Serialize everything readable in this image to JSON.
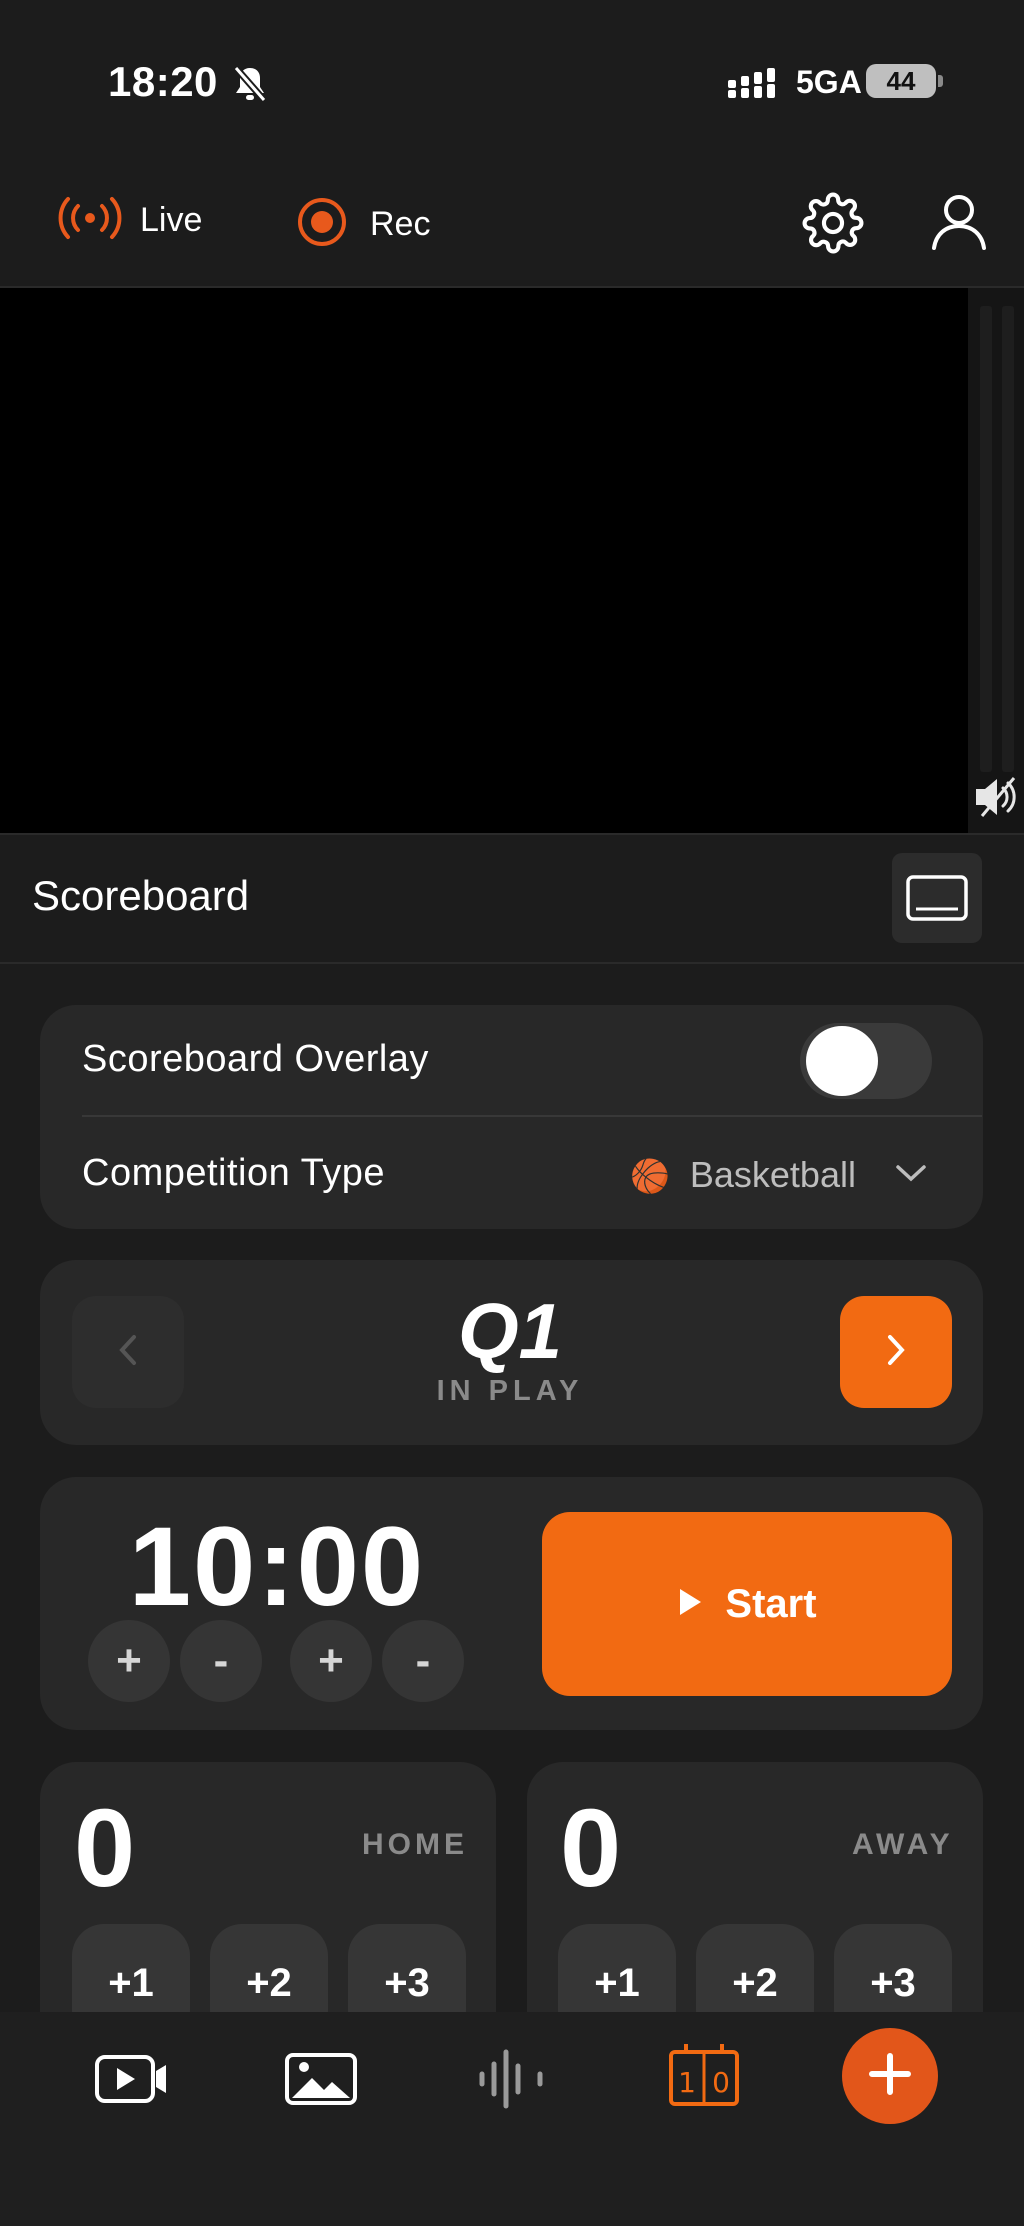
{
  "status_bar": {
    "time": "18:20",
    "network": "5GA",
    "battery": "44"
  },
  "header": {
    "live_label": "Live",
    "rec_label": "Rec"
  },
  "scoreboard": {
    "title": "Scoreboard",
    "overlay_label": "Scoreboard Overlay",
    "overlay_enabled": false,
    "competition_label": "Competition Type",
    "competition_value": "Basketball",
    "competition_emoji": "🏀"
  },
  "period": {
    "name": "Q1",
    "status": "IN PLAY"
  },
  "clock": {
    "time": "10:00",
    "start_label": "Start",
    "adjust_plus": "+",
    "adjust_minus": "-"
  },
  "home": {
    "label": "HOME",
    "score": "0",
    "buttons": [
      "+1",
      "+2",
      "+3"
    ]
  },
  "away": {
    "label": "AWAY",
    "score": "0",
    "buttons": [
      "+1",
      "+2",
      "+3"
    ]
  },
  "colors": {
    "accent": "#f26a12",
    "background": "#1c1c1c",
    "card": "#282828",
    "fab": "#e2561a"
  }
}
